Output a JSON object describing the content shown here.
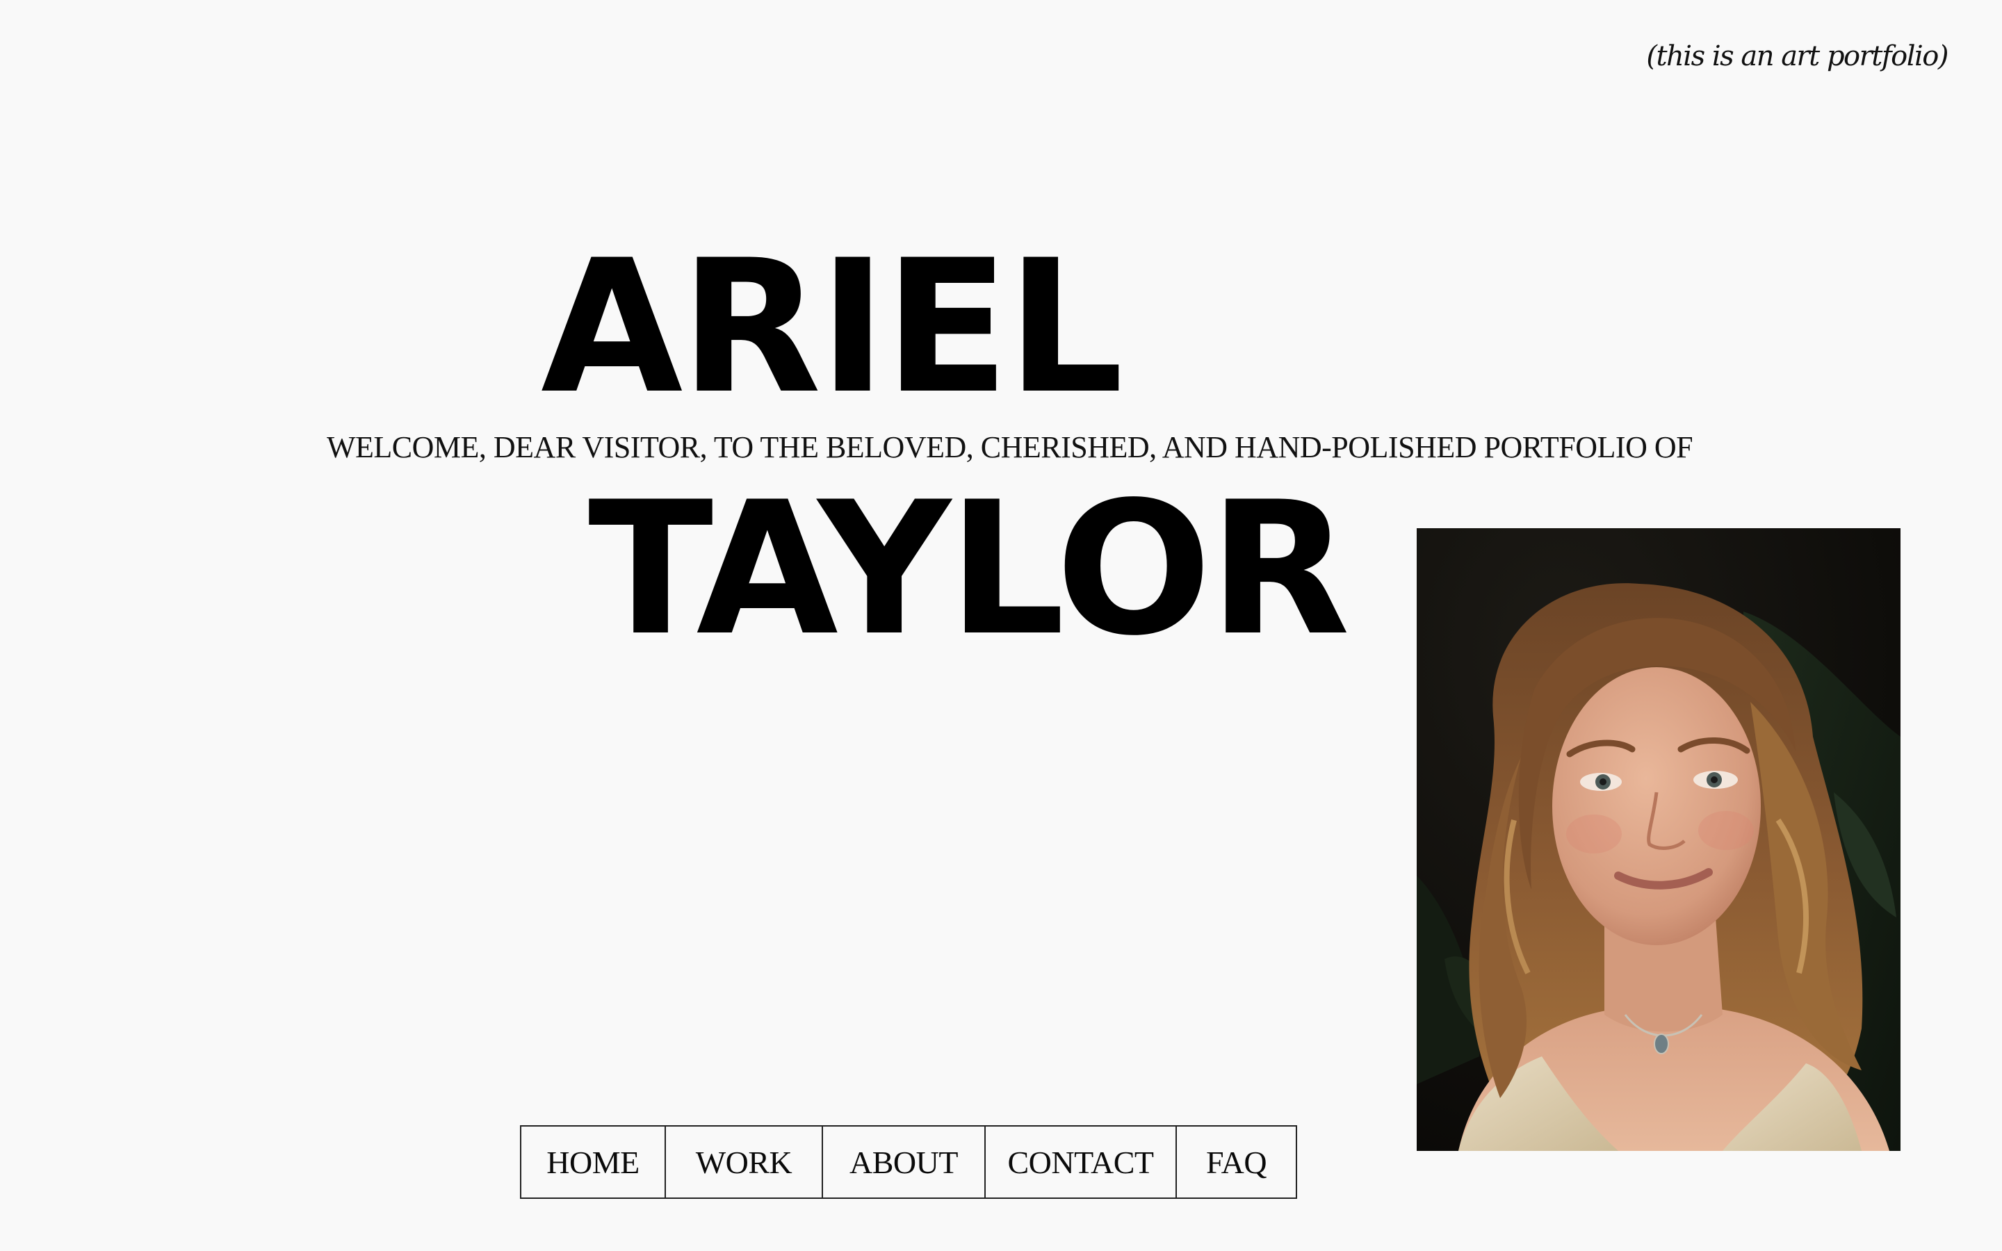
{
  "header": {
    "tagline": "(this is an art portfolio)"
  },
  "hero": {
    "first_name": "ARIEL",
    "welcome_text": "WELCOME, DEAR VISITOR, TO THE BELOVED, CHERISHED, AND HAND-POLISHED PORTFOLIO OF",
    "last_name": "TAYLOR"
  },
  "nav": {
    "items": [
      {
        "label": "HOME"
      },
      {
        "label": "WORK"
      },
      {
        "label": "ABOUT"
      },
      {
        "label": "CONTACT"
      },
      {
        "label": "FAQ"
      }
    ]
  },
  "colors": {
    "background": "#f9f9f9",
    "text": "#050505",
    "border": "#222222"
  }
}
